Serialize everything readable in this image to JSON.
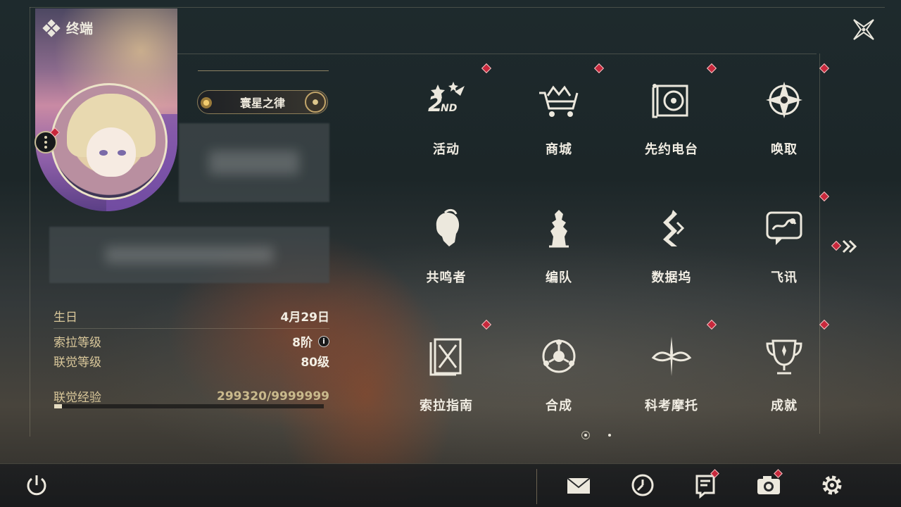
{
  "header": {
    "title": "终端"
  },
  "profile": {
    "title_badge": "寰星之律",
    "stats": [
      {
        "label": "生日",
        "value": "4月29日"
      },
      {
        "label": "索拉等级",
        "value": "8阶",
        "info": "i"
      },
      {
        "label": "联觉等级",
        "value": "80级"
      }
    ],
    "exp": {
      "label": "联觉经验",
      "value": "299320/9999999",
      "progress": 0.0299
    }
  },
  "menu": {
    "items": [
      {
        "label": "活动",
        "icon": "event-2nd-anniversary-icon",
        "badge": true
      },
      {
        "label": "商城",
        "icon": "shop-cart-icon",
        "badge": true
      },
      {
        "label": "先约电台",
        "icon": "radio-pass-icon",
        "badge": true
      },
      {
        "label": "唤取",
        "icon": "convene-compass-icon",
        "badge": true
      },
      {
        "label": "共鸣者",
        "icon": "resonator-portrait-icon",
        "badge": false
      },
      {
        "label": "编队",
        "icon": "team-chess-icon",
        "badge": false
      },
      {
        "label": "数据坞",
        "icon": "data-bank-icon",
        "badge": false
      },
      {
        "label": "飞讯",
        "icon": "message-bubble-icon",
        "badge": true
      },
      {
        "label": "索拉指南",
        "icon": "guidebook-icon",
        "badge": true
      },
      {
        "label": "合成",
        "icon": "synthesis-icon",
        "badge": false
      },
      {
        "label": "科考摩托",
        "icon": "motorcycle-icon",
        "badge": true
      },
      {
        "label": "成就",
        "icon": "trophy-icon",
        "badge": true
      }
    ],
    "page": {
      "current": 1,
      "total": 2
    }
  },
  "bottom_bar": {
    "buttons": [
      "power-icon",
      "mail-icon",
      "clock-icon",
      "notice-icon",
      "camera-icon",
      "settings-gear-icon"
    ]
  },
  "colors": {
    "accent_gold": "#d9c79a",
    "badge_red": "#c8283c",
    "text": "#f1ede3"
  }
}
